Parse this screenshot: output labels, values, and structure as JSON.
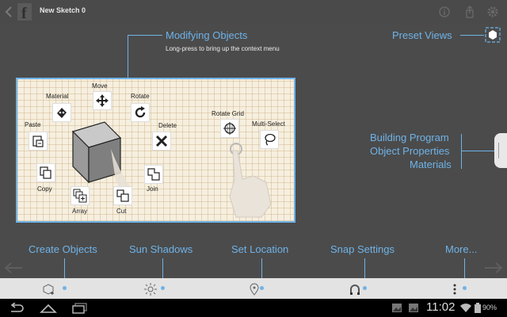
{
  "header": {
    "title": "New Sketch 0",
    "icons": [
      "back-arrow-icon",
      "app-logo-icon",
      "info-icon",
      "share-icon",
      "settings-icon"
    ]
  },
  "hints": {
    "modifying_title": "Modifying Objects",
    "modifying_sub": "Long-press to bring up the context menu",
    "preset_views": "Preset Views",
    "building_program": "Building Program",
    "object_properties": "Object Properties",
    "materials": "Materials",
    "create_objects": "Create Objects",
    "sun_shadows": "Sun Shadows",
    "set_location": "Set Location",
    "snap_settings": "Snap Settings",
    "more": "More..."
  },
  "context_menu": {
    "material": "Material",
    "move": "Move",
    "rotate": "Rotate",
    "paste": "Paste",
    "delete": "Delete",
    "copy": "Copy",
    "join": "Join",
    "array": "Array",
    "cut": "Cut",
    "rotate_grid": "Rotate Grid",
    "multi_select": "Multi-Select"
  },
  "status": {
    "time": "11:02",
    "battery": "90%"
  },
  "colors": {
    "accent": "#6fb3e8",
    "background": "#4b4b4b",
    "toolbar": "#e3e3e3"
  }
}
